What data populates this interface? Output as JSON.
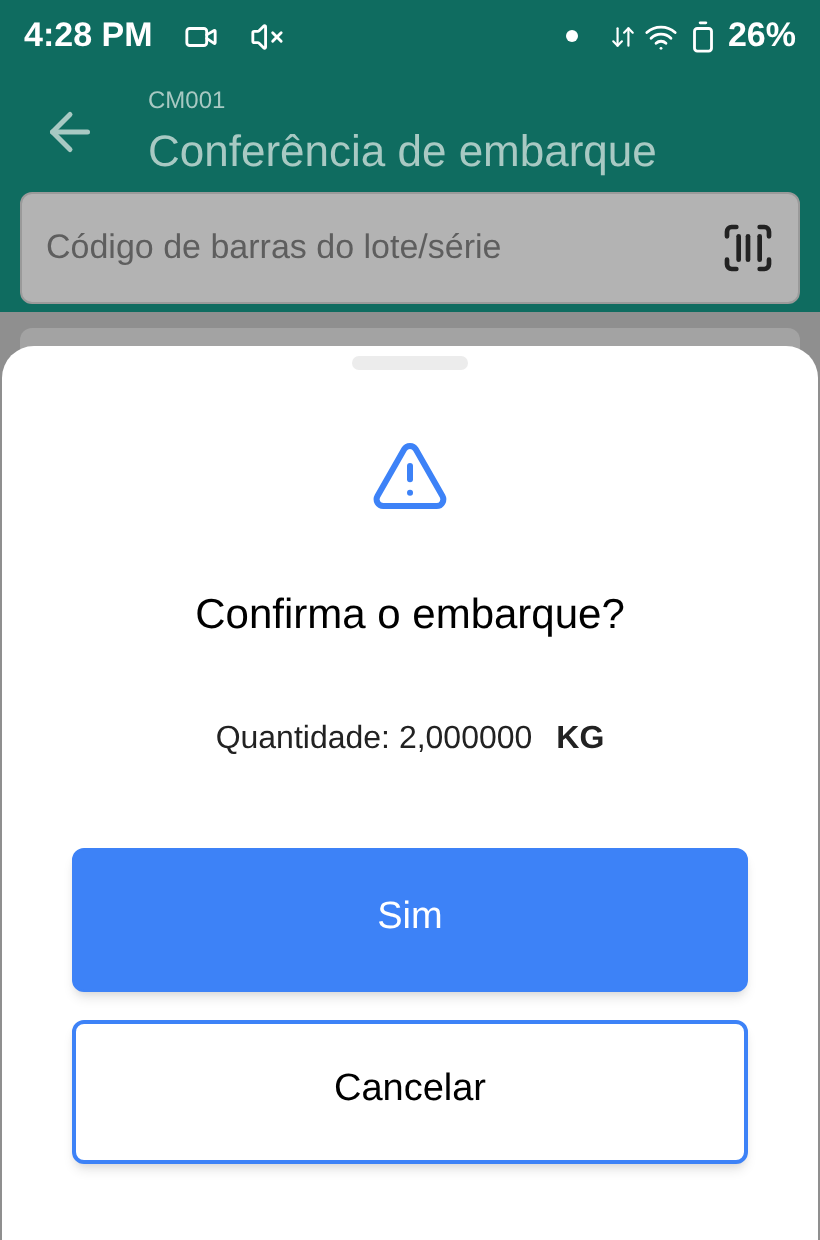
{
  "status_bar": {
    "time": "4:28 PM",
    "battery": "26%"
  },
  "header": {
    "subtitle": "CM001",
    "title": "Conferência de embarque"
  },
  "search": {
    "placeholder": "Código de barras do lote/série"
  },
  "dialog": {
    "title": "Confirma o embarque?",
    "quantity": "Quantidade: 2,000000",
    "unit": "KG",
    "buttons": [
      {
        "label": "Sim",
        "kind": "primary"
      },
      {
        "label": "Cancelar",
        "kind": "secondary"
      }
    ]
  }
}
